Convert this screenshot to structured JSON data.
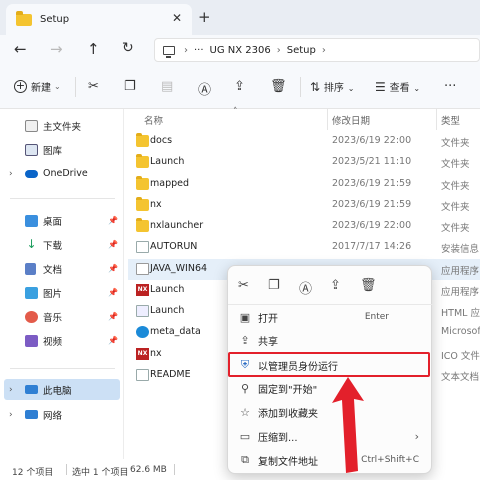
{
  "tab": {
    "title": "Setup"
  },
  "address": {
    "crumbs": [
      "UG NX 2306",
      "Setup"
    ]
  },
  "toolbar": {
    "new_label": "新建",
    "sort_label": "排序",
    "view_label": "查看"
  },
  "sidebar": {
    "items": [
      {
        "label": "主文件夹"
      },
      {
        "label": "图库"
      },
      {
        "label": "OneDrive"
      },
      {
        "label": "桌面"
      },
      {
        "label": "下载"
      },
      {
        "label": "文档"
      },
      {
        "label": "图片"
      },
      {
        "label": "音乐"
      },
      {
        "label": "视频"
      },
      {
        "label": "此电脑"
      },
      {
        "label": "网络"
      }
    ]
  },
  "columns": {
    "name": "名称",
    "date": "修改日期",
    "type": "类型"
  },
  "files": [
    {
      "name": "docs",
      "date": "2023/6/19 22:00",
      "type": "文件夹"
    },
    {
      "name": "Launch",
      "date": "2023/5/21 11:10",
      "type": "文件夹"
    },
    {
      "name": "mapped",
      "date": "2023/6/19 21:59",
      "type": "文件夹"
    },
    {
      "name": "nx",
      "date": "2023/6/19 21:59",
      "type": "文件夹"
    },
    {
      "name": "nxlauncher",
      "date": "2023/6/19 22:00",
      "type": "文件夹"
    },
    {
      "name": "AUTORUN",
      "date": "2017/7/17 14:26",
      "type": "安装信息"
    },
    {
      "name": "JAVA_WIN64",
      "date": "",
      "type": "应用程序"
    },
    {
      "name": "Launch",
      "date": "",
      "type": "应用程序"
    },
    {
      "name": "Launch",
      "date": "",
      "type": "HTML 应"
    },
    {
      "name": "meta_data",
      "date": "",
      "type": "Microsof"
    },
    {
      "name": "nx",
      "date": "",
      "type": "ICO 文件"
    },
    {
      "name": "README",
      "date": "",
      "type": "文本文档"
    }
  ],
  "status": {
    "count": "12 个项目",
    "selected": "选中 1 个项目",
    "size": "62.6 MB"
  },
  "context_menu": {
    "items": [
      {
        "label": "打开",
        "key": "Enter"
      },
      {
        "label": "共享",
        "key": ""
      },
      {
        "label": "以管理员身份运行",
        "key": ""
      },
      {
        "label": "固定到\"开始\"",
        "key": ""
      },
      {
        "label": "添加到收藏夹",
        "key": ""
      },
      {
        "label": "压缩到...",
        "key": ""
      },
      {
        "label": "复制文件地址",
        "key": "Ctrl+Shift+C"
      }
    ]
  },
  "colors": {
    "highlight": "#e3202b",
    "accent": "#1b8ad8",
    "selection": "#cce0f5"
  }
}
